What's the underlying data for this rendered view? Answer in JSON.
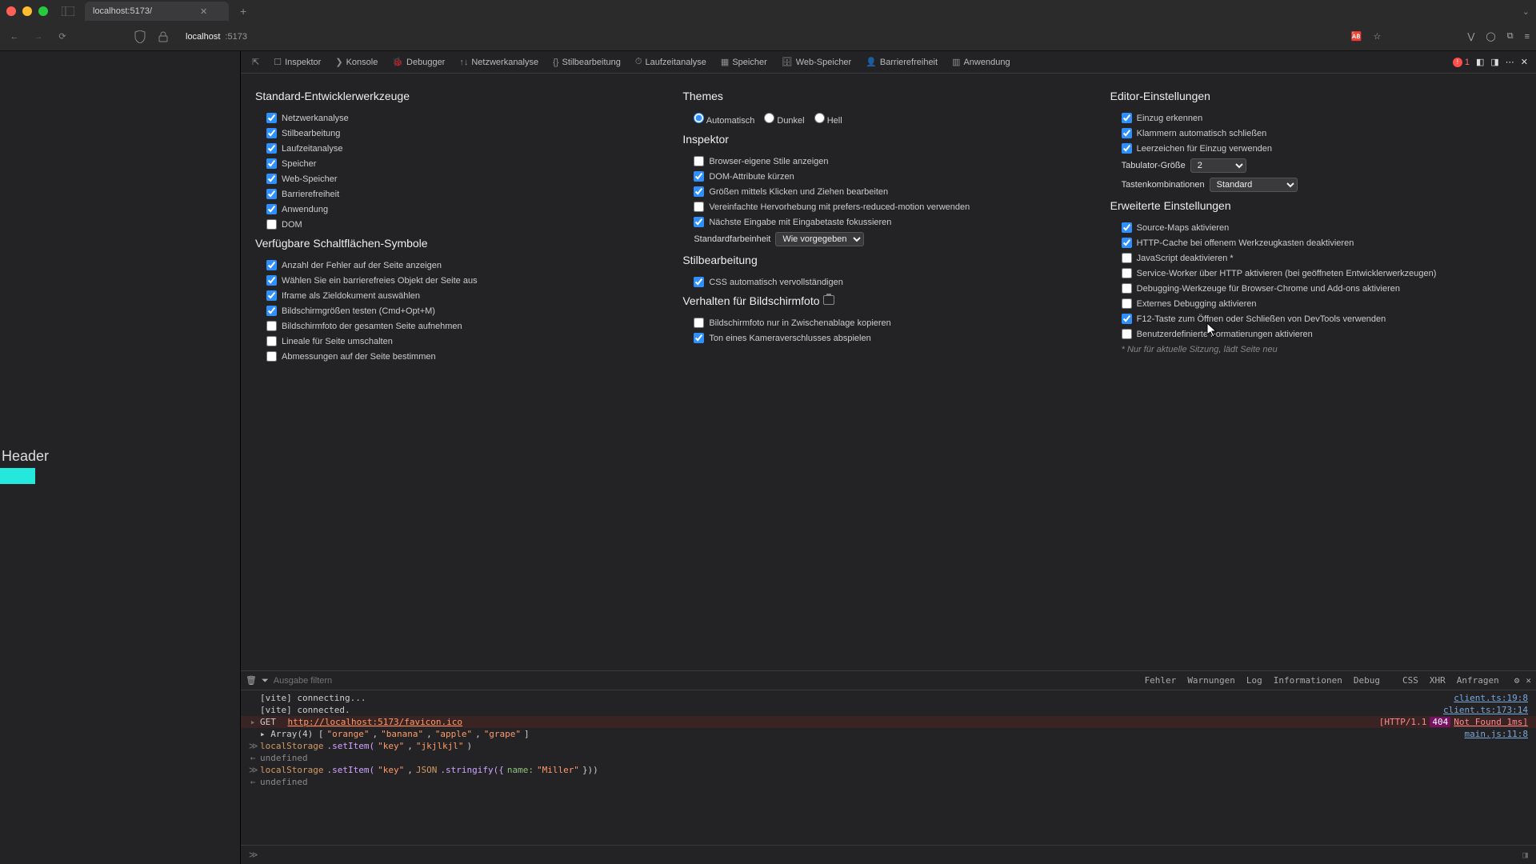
{
  "browser": {
    "tab_title": "localhost:5173/",
    "url_host": "localhost",
    "url_port": ":5173",
    "newtab": "+"
  },
  "page": {
    "header": "Header"
  },
  "devtools_tabs": {
    "inspektor": "Inspektor",
    "konsole": "Konsole",
    "debugger": "Debugger",
    "netzwerk": "Netzwerkanalyse",
    "stil": "Stilbearbeitung",
    "laufzeit": "Laufzeitanalyse",
    "speicher": "Speicher",
    "webspeicher": "Web-Speicher",
    "barrierefreiheit": "Barrierefreiheit",
    "anwendung": "Anwendung",
    "err_count": "1"
  },
  "settings": {
    "col1": {
      "std_title": "Standard-Entwicklerwerkzeuge",
      "netzwerk": "Netzwerkanalyse",
      "stil": "Stilbearbeitung",
      "laufzeit": "Laufzeitanalyse",
      "speicher": "Speicher",
      "webspeicher": "Web-Speicher",
      "barrierefreiheit": "Barrierefreiheit",
      "anwendung": "Anwendung",
      "dom": "DOM",
      "buttons_title": "Verfügbare Schaltflächen-Symbole",
      "b1": "Anzahl der Fehler auf der Seite anzeigen",
      "b2": "Wählen Sie ein barrierefreies Objekt der Seite aus",
      "b3": "Iframe als Zieldokument auswählen",
      "b4": "Bildschirmgrößen testen (Cmd+Opt+M)",
      "b5": "Bildschirmfoto der gesamten Seite aufnehmen",
      "b6": "Lineale für Seite umschalten",
      "b7": "Abmessungen auf der Seite bestimmen"
    },
    "col2": {
      "themes_title": "Themes",
      "theme_auto": "Automatisch",
      "theme_dark": "Dunkel",
      "theme_light": "Hell",
      "inspektor_title": "Inspektor",
      "i1": "Browser-eigene Stile anzeigen",
      "i2": "DOM-Attribute kürzen",
      "i3": "Größen mittels Klicken und Ziehen bearbeiten",
      "i4": "Vereinfachte Hervorhebung mit prefers-reduced-motion verwenden",
      "i5": "Nächste Eingabe mit Eingabetaste fokussieren",
      "i6_label": "Standardfarbeinheit",
      "i6_value": "Wie vorgegeben",
      "stil_title": "Stilbearbeitung",
      "s1": "CSS automatisch vervollständigen",
      "shot_title": "Verhalten für Bildschirmfoto",
      "sh1": "Bildschirmfoto nur in Zwischenablage kopieren",
      "sh2": "Ton eines Kameraverschlusses abspielen"
    },
    "col3": {
      "editor_title": "Editor-Einstellungen",
      "e1": "Einzug erkennen",
      "e2": "Klammern automatisch schließen",
      "e3": "Leerzeichen für Einzug verwenden",
      "e4_label": "Tabulator-Größe",
      "e4_value": "2",
      "e5_label": "Tastenkombinationen",
      "e5_value": "Standard",
      "adv_title": "Erweiterte Einstellungen",
      "a1": "Source-Maps aktivieren",
      "a2": "HTTP-Cache bei offenem Werkzeugkasten deaktivieren",
      "a3": "JavaScript deaktivieren *",
      "a4": "Service-Worker über HTTP aktivieren (bei geöffneten Entwicklerwerkzeugen)",
      "a5": "Debugging-Werkzeuge für Browser-Chrome und Add-ons aktivieren",
      "a6": "Externes Debugging aktivieren",
      "a7": "F12-Taste zum Öffnen oder Schließen von DevTools verwenden",
      "a8": "Benutzerdefinierte Formatierungen aktivieren",
      "note": "* Nur für aktuelle Sitzung, lädt Seite neu"
    }
  },
  "console": {
    "filter_placeholder": "Ausgabe filtern",
    "filters": {
      "fehler": "Fehler",
      "warnungen": "Warnungen",
      "log": "Log",
      "informationen": "Informationen",
      "debug": "Debug",
      "css": "CSS",
      "xhr": "XHR",
      "anfragen": "Anfragen"
    },
    "lines": {
      "l1": "[vite] connecting...",
      "l1_src": "client.ts:19:8",
      "l2": "[vite] connected.",
      "l2_src": "client.ts:173:14",
      "l3_method": "GET",
      "l3_url": "http://localhost:5173/favicon.ico",
      "l3_proto": "[HTTP/1.1",
      "l3_status": "404",
      "l3_rest": "Not Found 1ms]",
      "l4_pre": "▸ Array(4) [ ",
      "l4_a": "\"orange\"",
      "l4_b": "\"banana\"",
      "l4_c": "\"apple\"",
      "l4_d": "\"grape\"",
      "l4_post": " ]",
      "l4_src": "main.js:11:8",
      "l5_obj": "localStorage",
      "l5_fn": ".setItem(",
      "l5_k": "\"key\"",
      "l5_sep": ", ",
      "l5_v": "\"jkjlkjl\"",
      "l5_end": ")",
      "l6": "undefined",
      "l7_obj": "localStorage",
      "l7_fn": ".setItem(",
      "l7_k": "\"key\"",
      "l7_sep": ", ",
      "l7_json": "JSON",
      "l7_str": ".stringify({ ",
      "l7_name": "name: ",
      "l7_val": "\"Miller\"",
      "l7_end": "}))",
      "l8": "undefined"
    }
  }
}
